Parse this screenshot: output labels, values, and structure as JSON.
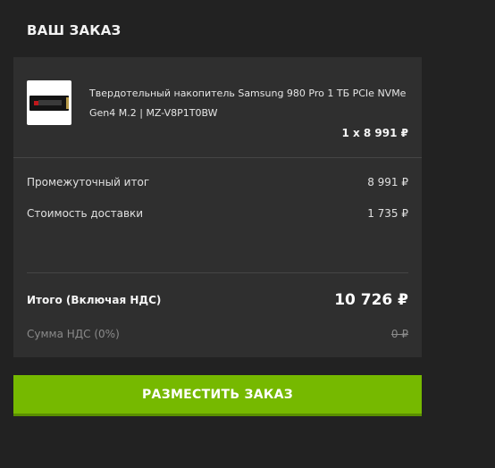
{
  "order": {
    "title": "ВАШ ЗАКАЗ",
    "product": {
      "name": "Твердотельный накопитель Samsung 980 Pro 1 ТБ PCIe NVMe Gen4 M.2 | MZ-V8P1T0BW",
      "quantity_price": "1 x 8 991 ₽",
      "thumbnail_icon": "ssd-icon"
    },
    "subtotal": {
      "label": "Промежуточный итог",
      "value": "8 991 ₽"
    },
    "shipping": {
      "label": "Стоимость доставки",
      "value": "1 735 ₽"
    },
    "total": {
      "label": "Итого (Включая НДС)",
      "value": "10 726 ₽"
    },
    "vat": {
      "label": "Сумма НДС (0%)",
      "value": "0 ₽"
    },
    "place_order_label": "РАЗМЕСТИТЬ ЗАКАЗ"
  },
  "colors": {
    "background": "#222222",
    "panel": "#2f2f2f",
    "accent": "#76b900"
  }
}
